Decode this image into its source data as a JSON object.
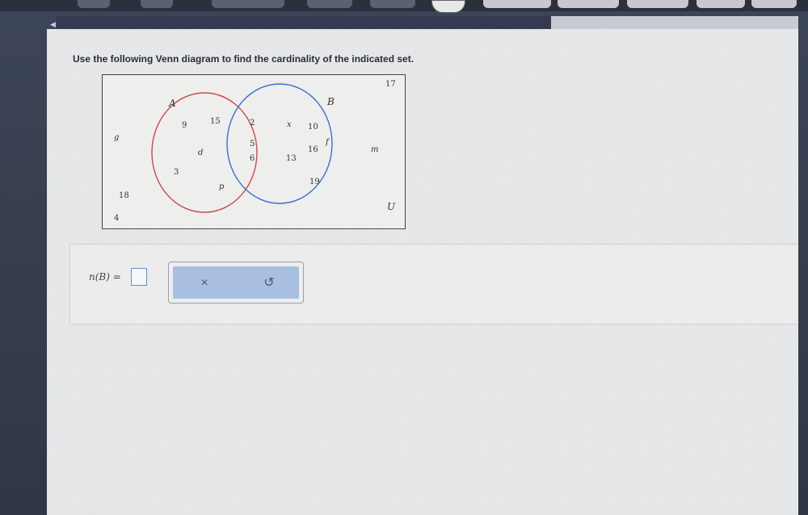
{
  "question": {
    "prompt": "Use the following Venn diagram to find the cardinality of the indicated set."
  },
  "venn": {
    "set_a_label": "A",
    "set_b_label": "B",
    "universe_label": "U",
    "colors": {
      "set_a": "#d0474b",
      "set_b": "#3d6fd0"
    },
    "elements": {
      "a_only": [
        "9",
        "15",
        "d",
        "3",
        "p"
      ],
      "a_and_b": [
        "2",
        "5",
        "6"
      ],
      "b_only": [
        "x",
        "10",
        "16",
        "f",
        "13",
        "19"
      ],
      "outside": [
        "17",
        "g",
        "18",
        "4",
        "m"
      ]
    }
  },
  "answer": {
    "label": "n(B) =",
    "value": ""
  },
  "tools": {
    "clear_symbol": "×",
    "undo_symbol": "↺"
  }
}
